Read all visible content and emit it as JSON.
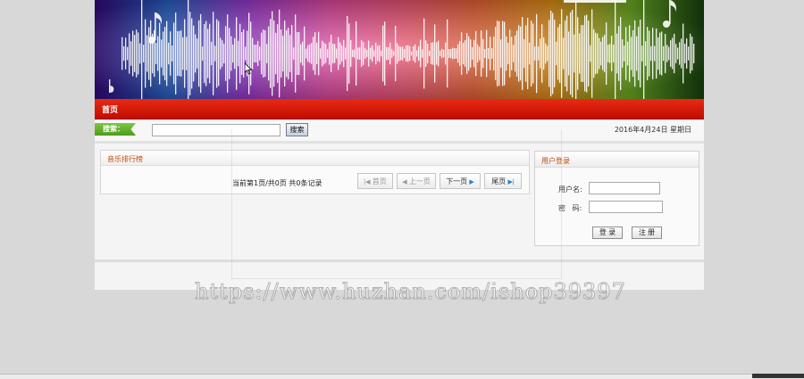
{
  "nav": {
    "home": "首页"
  },
  "search": {
    "tag": "搜索：",
    "button": "搜索",
    "value": "",
    "date": "2016年4月24日  星期日"
  },
  "ranking": {
    "title": "音乐排行榜",
    "pager_info": "当前第1页/共0页  共0条记录",
    "first": "首页",
    "prev": "上一页",
    "next": "下一页",
    "last": "尾页"
  },
  "login": {
    "title": "用户登录",
    "username_label": "用户名:",
    "password_label": "密   码:",
    "username_value": "",
    "password_value": "",
    "login_button": "登 录",
    "register_button": "注 册"
  },
  "watermark": "https://www.huzhan.com/ishop39397",
  "colors": {
    "nav_red": "#d81e0a",
    "tag_green": "#5fae2a",
    "title_orange": "#c24a10"
  }
}
